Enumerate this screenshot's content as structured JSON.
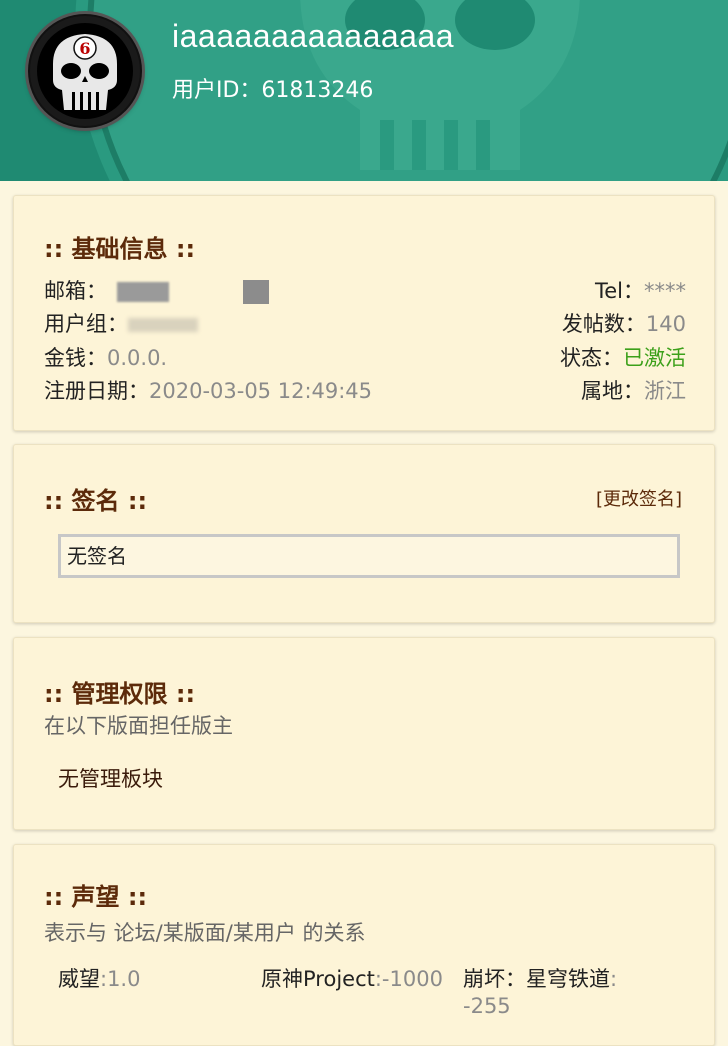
{
  "header": {
    "username": "iaaaaaaaaaaaaaaa",
    "user_id": "用户ID：61813246",
    "avatar_badge": "6",
    "colors": {
      "background": "#1f8a72"
    }
  },
  "basic_info": {
    "title": ":: 基础信息 ::",
    "email_label": "邮箱：",
    "tel_label": "Tel：",
    "tel_value": "****",
    "usergroup_label": "用户组：",
    "posts_label": "发帖数：",
    "posts_value": "140",
    "money_label": "金钱：",
    "money_value": "0.0.0.",
    "status_label": "状态：",
    "status_value": "已激活",
    "regdate_label": "注册日期：",
    "regdate_value": "2020-03-05 12:49:45",
    "location_label": "属地：",
    "location_value": "浙江"
  },
  "signature": {
    "title": ":: 签名 ::",
    "edit_label": "[更改签名]",
    "value": "无签名"
  },
  "admin": {
    "title": ":: 管理权限 ::",
    "desc": "在以下版面担任版主",
    "value": "无管理板块"
  },
  "reputation": {
    "title": ":: 声望 ::",
    "desc": "表示与 论坛/某版面/某用户 的关系",
    "items": [
      {
        "label": "威望",
        "value": ":1.0"
      },
      {
        "label": "原神Project",
        "value": ":-1000"
      },
      {
        "label": "崩坏：星穹铁道",
        "value": ":"
      },
      {
        "label": "",
        "value": "-255"
      }
    ]
  },
  "colors": {
    "accent_title": "#5c2a0a",
    "status_active": "#3ca01a",
    "card_bg": "#fdf4d7",
    "page_bg": "#fcf6df"
  }
}
